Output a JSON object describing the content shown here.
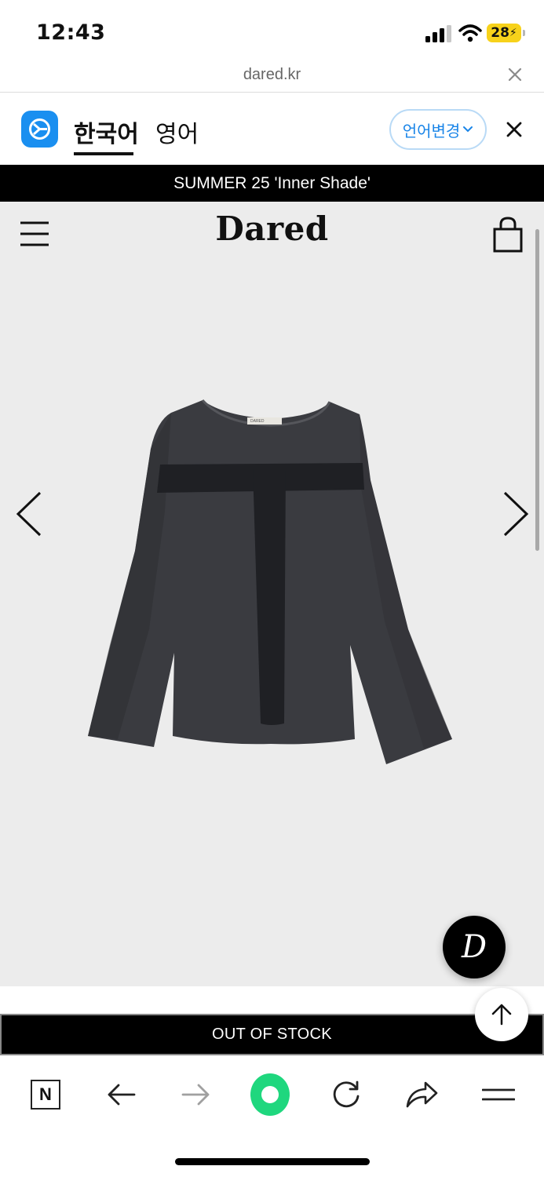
{
  "status_bar": {
    "time": "12:43",
    "battery": "28"
  },
  "url_bar": {
    "url": "dared.kr",
    "close_icon": "close-icon"
  },
  "translation_bar": {
    "tabs": [
      {
        "label": "한국어",
        "active": true
      },
      {
        "label": "영어",
        "active": false
      }
    ],
    "change_language": "언어변경",
    "icon": "papago-icon",
    "accent_color": "#1a85e8"
  },
  "announcement": "SUMMER 25 'Inner Shade'",
  "header": {
    "logo": "Dared",
    "menu_icon": "hamburger-icon",
    "cart_icon": "shopping-bag-icon"
  },
  "product": {
    "image": "dark-long-sleeve-top",
    "label_text": "DARED",
    "nav": {
      "prev": "chevron-left-icon",
      "next": "chevron-right-icon"
    },
    "badge": "D"
  },
  "stock_button": "OUT OF STOCK",
  "toolbar": {
    "items": [
      "naver-icon",
      "back-icon",
      "forward-icon",
      "green-dot-icon",
      "refresh-icon",
      "share-icon",
      "menu-icon"
    ],
    "naver_letter": "N"
  }
}
